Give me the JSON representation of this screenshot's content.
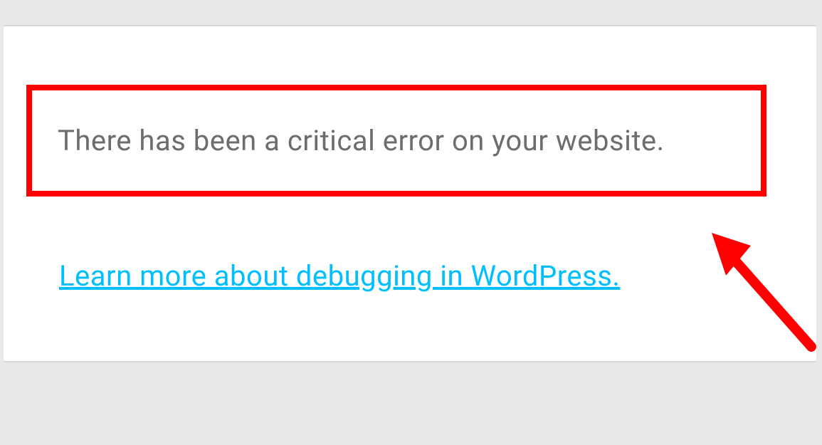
{
  "error": {
    "message": "There has been a critical error on your website."
  },
  "link": {
    "label": "Learn more about debugging in WordPress."
  }
}
